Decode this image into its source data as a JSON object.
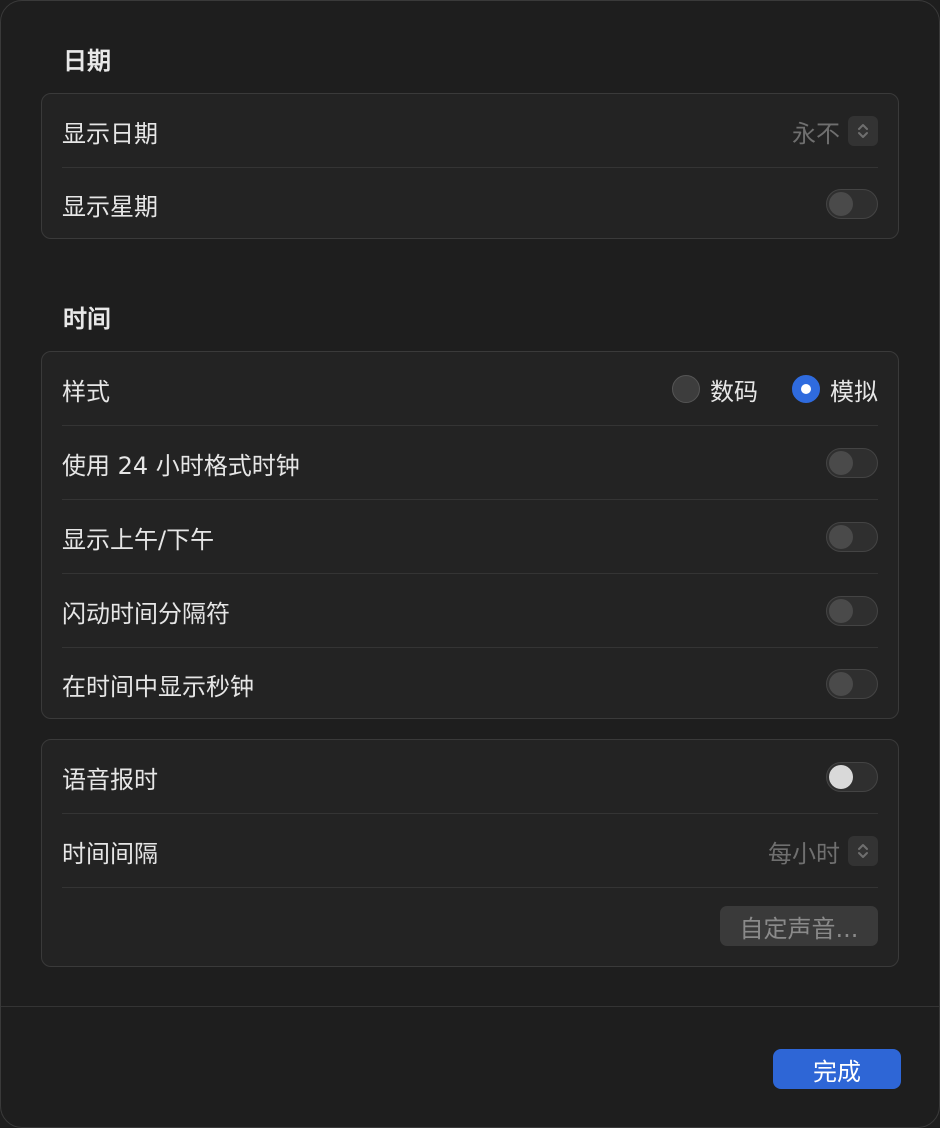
{
  "date_section": {
    "title": "日期",
    "show_date": {
      "label": "显示日期",
      "value": "永不"
    },
    "show_weekday": {
      "label": "显示星期",
      "on": false
    }
  },
  "time_section": {
    "title": "时间",
    "style": {
      "label": "样式",
      "options": [
        "数码",
        "模拟"
      ],
      "selected": "模拟"
    },
    "use_24h": {
      "label": "使用 24 小时格式时钟",
      "on": false
    },
    "show_ampm": {
      "label": "显示上午/下午",
      "on": false
    },
    "flash_separators": {
      "label": "闪动时间分隔符",
      "on": false
    },
    "show_seconds": {
      "label": "在时间中显示秒钟",
      "on": false
    }
  },
  "announce_section": {
    "announce_time": {
      "label": "语音报时",
      "on": false
    },
    "interval": {
      "label": "时间间隔",
      "value": "每小时"
    },
    "custom_voice_label": "自定声音..."
  },
  "footer": {
    "done_label": "完成"
  },
  "colors": {
    "accent": "#2e66d6",
    "background": "#1e1e1e",
    "group_background": "#232323"
  }
}
